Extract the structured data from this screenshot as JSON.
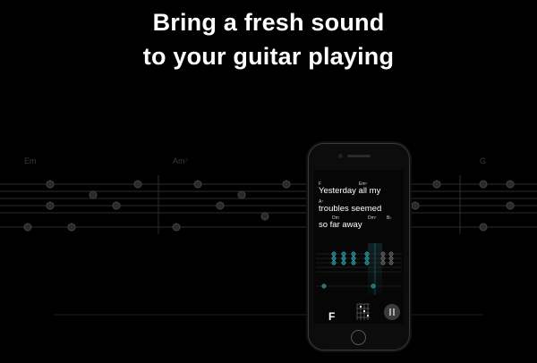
{
  "headline": {
    "line1": "Bring a fresh sound",
    "line2": "to your guitar playing"
  },
  "background": {
    "chord_labels": [
      "Em",
      "Am⁷",
      "G"
    ]
  },
  "phone": {
    "lyrics": [
      {
        "chords": [
          "F",
          "Em⁷"
        ],
        "text": "Yesterday all my"
      },
      {
        "chords": [
          "A⁷"
        ],
        "text": "troubles seemed"
      },
      {
        "chords": [
          "Dm",
          "Dm⁷",
          "B♭"
        ],
        "text": "so far away"
      }
    ],
    "current_chord": "F",
    "controls": {
      "pause_icon": "pause-icon"
    },
    "accent_color": "#39c5cf"
  }
}
